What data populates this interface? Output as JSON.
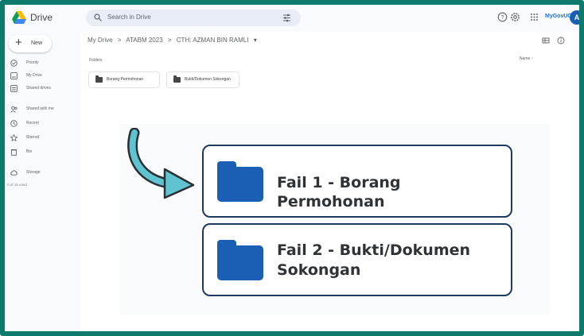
{
  "app": {
    "title": "Drive",
    "brand": "MyGovUC",
    "avatar_letter": "A"
  },
  "search": {
    "placeholder": "Search in Drive"
  },
  "sidebar": {
    "new_label": "New",
    "items": [
      {
        "label": "Priority",
        "icon": "priority-icon"
      },
      {
        "label": "My Drive",
        "icon": "my-drive-icon"
      },
      {
        "label": "Shared drives",
        "icon": "shared-drives-icon"
      },
      {
        "label": "Shared with me",
        "icon": "shared-with-me-icon"
      },
      {
        "label": "Recent",
        "icon": "recent-icon"
      },
      {
        "label": "Starred",
        "icon": "starred-icon"
      },
      {
        "label": "Bin",
        "icon": "bin-icon"
      },
      {
        "label": "Storage",
        "icon": "storage-icon"
      }
    ],
    "storage_text": "0 of 15 used"
  },
  "breadcrumb": {
    "items": [
      "My Drive",
      "ATABM 2023",
      "CTH: AZMAN BIN RAMLI"
    ],
    "separator": ">",
    "dropdown": "▾"
  },
  "main": {
    "folders_label": "Folders",
    "sort_label": "Name",
    "sort_arrow": "↑",
    "folders": [
      "Borang Permohonan",
      "Bukti/Dokumen Sokongan"
    ]
  },
  "callouts": [
    {
      "line1": "Fail 1 - Borang Permohonan",
      "line2": ""
    },
    {
      "line1": "Fail 2 - Bukti/Dokumen",
      "line2": "Sokongan"
    }
  ],
  "colors": {
    "frame": "#0d7a6c",
    "folder_blue": "#1a5fb4",
    "card_border": "#1e3a5f",
    "arrow": "#5fc4cf"
  }
}
